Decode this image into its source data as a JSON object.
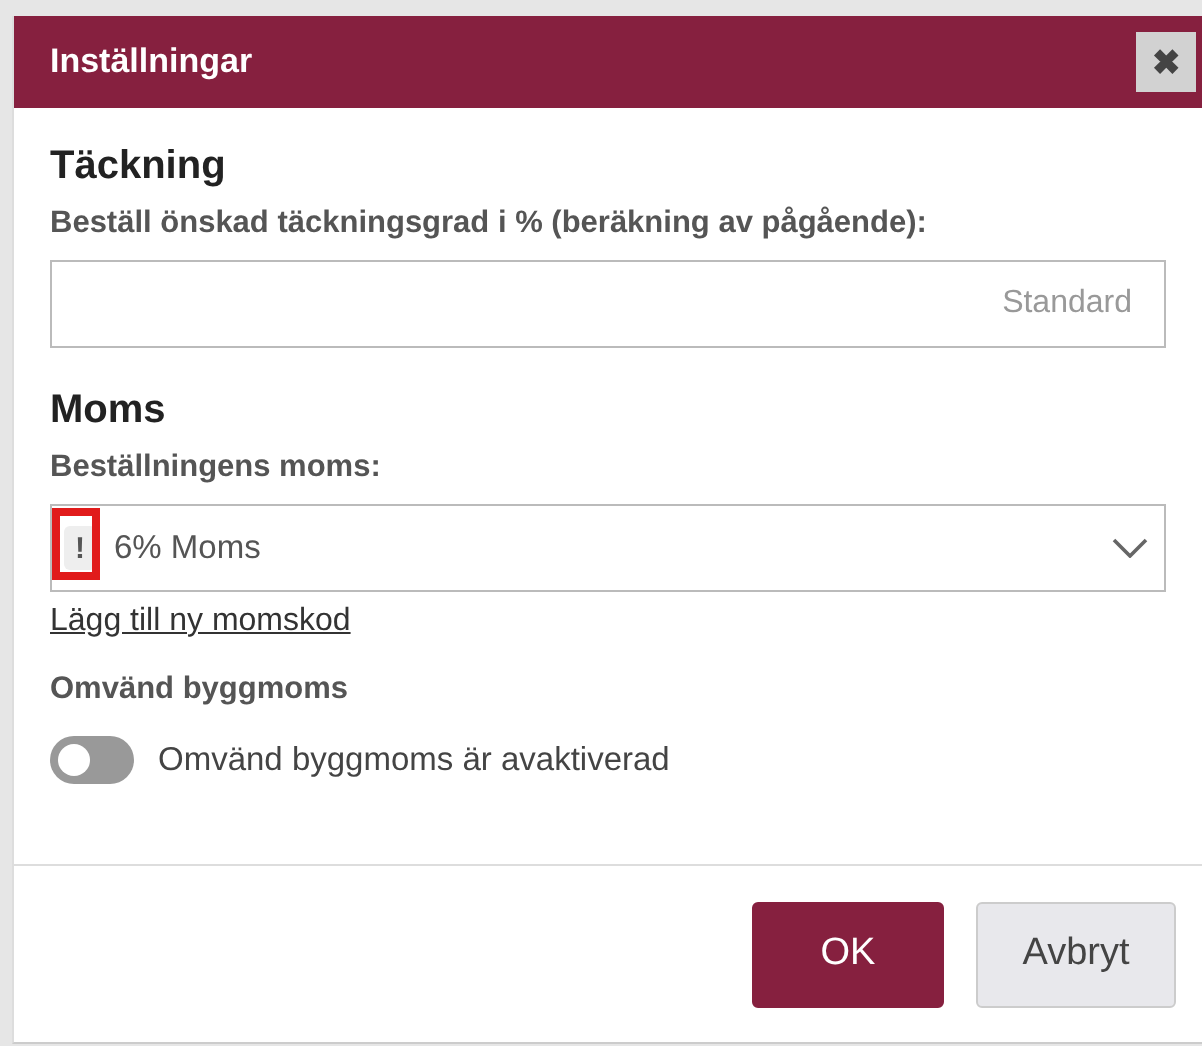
{
  "dialog": {
    "title": "Inställningar",
    "close_icon": "✖"
  },
  "coverage": {
    "heading": "Täckning",
    "label": "Beställ önskad täckningsgrad i % (beräkning av pågående):",
    "placeholder": "Standard"
  },
  "vat": {
    "heading": "Moms",
    "label": "Beställningens moms:",
    "warning": {
      "mark": "!",
      "highlighted": true
    },
    "value": "6% Moms",
    "link": "Lägg till ny momskod"
  },
  "reverse_vat": {
    "heading": "Omvänd byggmoms",
    "toggle": {
      "on": false,
      "label": "Omvänd byggmoms är avaktiverad"
    }
  },
  "buttons": [
    {
      "label": "OK",
      "kind": "primary"
    },
    {
      "label": "Avbryt",
      "kind": "secondary"
    }
  ]
}
